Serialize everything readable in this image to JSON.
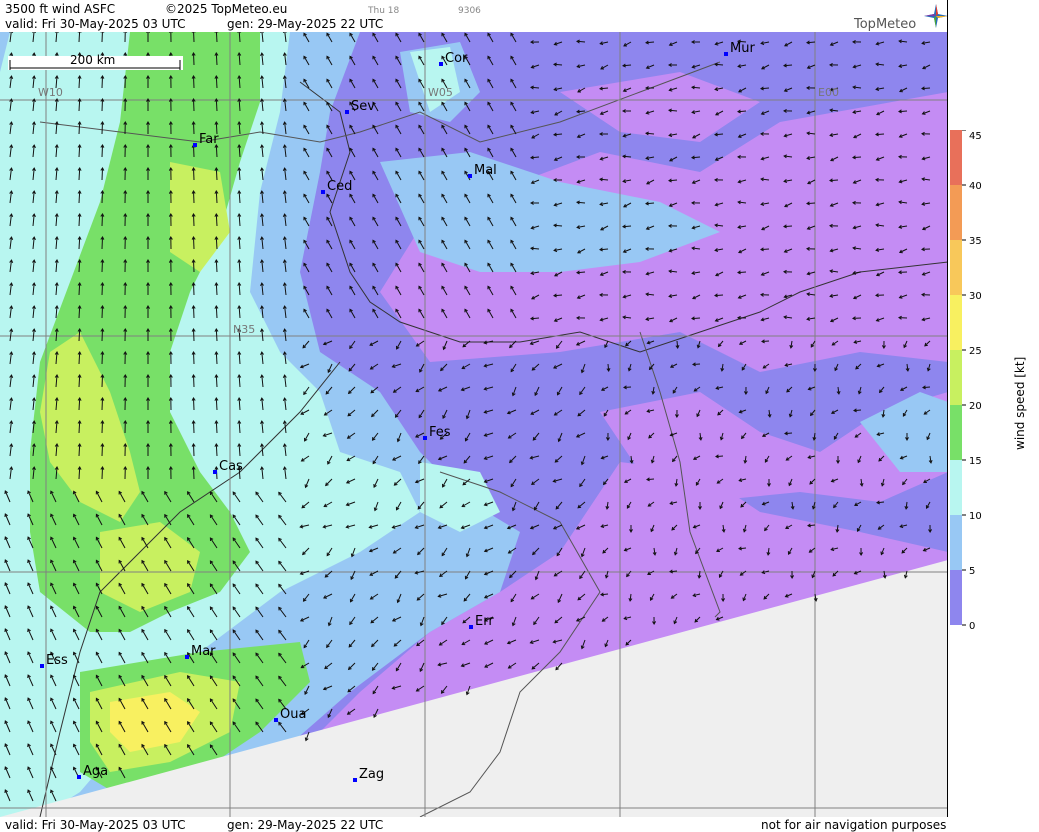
{
  "header": {
    "title": "3500 ft wind ASFC",
    "copyright": "©2025 TopMeteo.eu",
    "valid": "valid:  Fri  30-May-2025  03 UTC",
    "generated": "gen: 29-May-2025 22 UTC",
    "faint_day": "Thu 18",
    "faint_code": "9306",
    "logo_text": "TopMeteo"
  },
  "footer": {
    "valid": "valid:  Fri  30-May-2025  03 UTC",
    "generated": "gen: 29-May-2025 22 UTC",
    "disclaimer": "not for air navigation purposes"
  },
  "map": {
    "scale_label": "200 km",
    "grid_labels": {
      "w10": "W10",
      "w05": "W05",
      "e00": "E00",
      "n35": "N35"
    },
    "cities": [
      {
        "name": "Cor"
      },
      {
        "name": "Mur"
      },
      {
        "name": "Sev"
      },
      {
        "name": "Far"
      },
      {
        "name": "Mal"
      },
      {
        "name": "Ced"
      },
      {
        "name": "Fes"
      },
      {
        "name": "Cas"
      },
      {
        "name": "Err"
      },
      {
        "name": "Ess"
      },
      {
        "name": "Mar"
      },
      {
        "name": "Oua"
      },
      {
        "name": "Aga"
      },
      {
        "name": "Zag"
      }
    ]
  },
  "legend": {
    "title": "wind speed [kt]",
    "ticks": [
      "45",
      "40",
      "35",
      "30",
      "25",
      "20",
      "15",
      "10",
      "5",
      "0"
    ],
    "colors": [
      "#e8705a",
      "#f39b55",
      "#f8c85a",
      "#f8f060",
      "#c8f060",
      "#78e068",
      "#b8f6f0",
      "#98c8f4",
      "#8e86ee",
      "#c48cf4"
    ]
  }
}
